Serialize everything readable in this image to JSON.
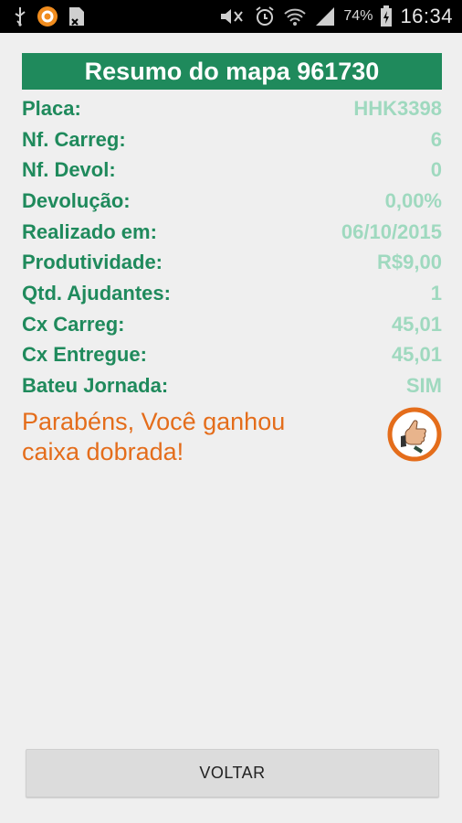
{
  "status_bar": {
    "battery_percent": "74%",
    "time": "16:34",
    "icons": [
      "usb-icon",
      "app-notification-icon",
      "document-icon",
      "mute-icon",
      "alarm-icon",
      "wifi-icon",
      "signal-icon",
      "battery-charging-icon"
    ]
  },
  "summary": {
    "title": "Resumo do mapa 961730",
    "rows": [
      {
        "label": "Placa:",
        "value": "HHK3398"
      },
      {
        "label": "Nf. Carreg:",
        "value": "6"
      },
      {
        "label": "Nf. Devol:",
        "value": "0"
      },
      {
        "label": "Devolução:",
        "value": "0,00%"
      },
      {
        "label": "Realizado em:",
        "value": "06/10/2015"
      },
      {
        "label": "Produtividade:",
        "value": "R$9,00"
      },
      {
        "label": "Qtd. Ajudantes:",
        "value": "1"
      },
      {
        "label": "Cx Carreg:",
        "value": "45,01"
      },
      {
        "label": "Cx Entregue:",
        "value": "45,01"
      },
      {
        "label": "Bateu Jornada:",
        "value": "SIM"
      }
    ],
    "congrats_line1": "Parabéns, Você ganhou",
    "congrats_line2": "caixa dobrada!"
  },
  "footer": {
    "back_label": "VOLTAR"
  },
  "colors": {
    "accent_green": "#1f8a5c",
    "value_green": "#9fd9bf",
    "orange": "#e46d1b"
  }
}
